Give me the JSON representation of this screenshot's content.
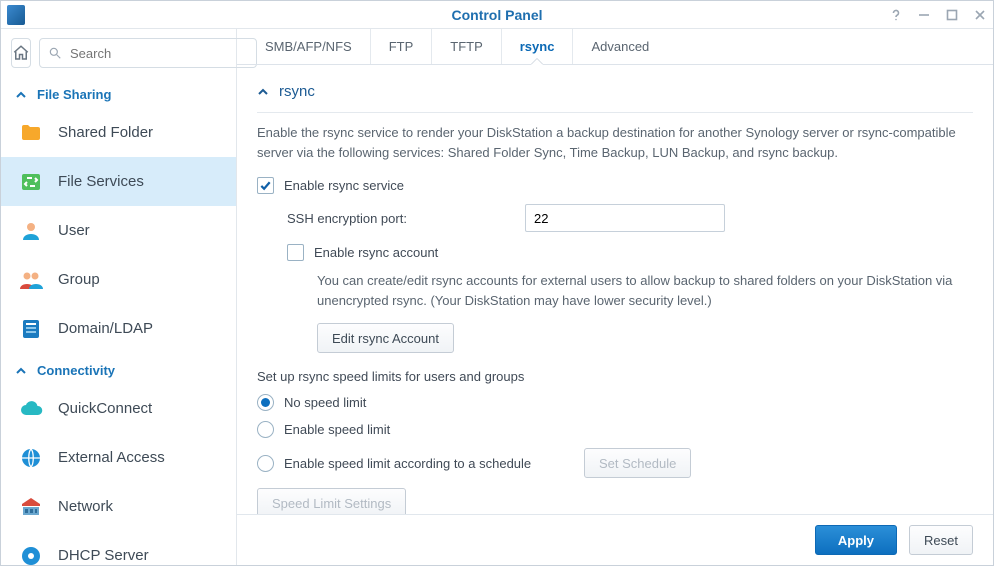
{
  "window": {
    "title": "Control Panel"
  },
  "search": {
    "placeholder": "Search"
  },
  "sidebar": {
    "sections": {
      "file_sharing": {
        "label": "File Sharing"
      },
      "connectivity": {
        "label": "Connectivity"
      }
    },
    "items": {
      "shared_folder": {
        "label": "Shared Folder"
      },
      "file_services": {
        "label": "File Services"
      },
      "user": {
        "label": "User"
      },
      "group": {
        "label": "Group"
      },
      "domain_ldap": {
        "label": "Domain/LDAP"
      },
      "quickconnect": {
        "label": "QuickConnect"
      },
      "external_access": {
        "label": "External Access"
      },
      "network": {
        "label": "Network"
      },
      "dhcp_server": {
        "label": "DHCP Server"
      }
    }
  },
  "tabs": {
    "smb": {
      "label": "SMB/AFP/NFS"
    },
    "ftp": {
      "label": "FTP"
    },
    "tftp": {
      "label": "TFTP"
    },
    "rsync": {
      "label": "rsync"
    },
    "adv": {
      "label": "Advanced"
    }
  },
  "rsync": {
    "section_title": "rsync",
    "description": "Enable the rsync service to render your DiskStation a backup destination for another Synology server or rsync-compatible server via the following services: Shared Folder Sync, Time Backup, LUN Backup, and rsync backup.",
    "enable_service_label": "Enable rsync service",
    "ssh_port_label": "SSH encryption port:",
    "ssh_port_value": "22",
    "enable_account_label": "Enable rsync account",
    "account_note": "You can create/edit rsync accounts for external users to allow backup to shared folders on your DiskStation via unencrypted rsync. (Your DiskStation may have lower security level.)",
    "edit_account_btn": "Edit rsync Account",
    "speed_subhead": "Set up rsync speed limits for users and groups",
    "radio_none": "No speed limit",
    "radio_enable": "Enable speed limit",
    "radio_schedule": "Enable speed limit according to a schedule",
    "set_schedule_btn": "Set Schedule",
    "speed_settings_btn": "Speed Limit Settings"
  },
  "footer": {
    "apply": "Apply",
    "reset": "Reset"
  }
}
